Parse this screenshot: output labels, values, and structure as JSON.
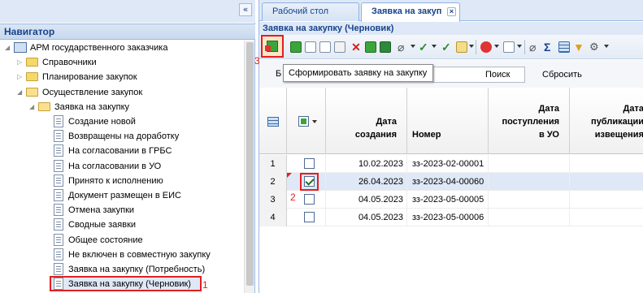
{
  "navigator": {
    "collapse_icon": "«",
    "title": "Навигатор",
    "tree": [
      {
        "label": "АРМ государственного заказчика",
        "kind": "apm",
        "indent": 0,
        "expanded": true
      },
      {
        "label": "Справочники",
        "kind": "folder",
        "indent": 1,
        "expanded": false
      },
      {
        "label": "Планирование закупок",
        "kind": "folder",
        "indent": 1,
        "expanded": false
      },
      {
        "label": "Осуществление закупок",
        "kind": "folder",
        "indent": 1,
        "expanded": true
      },
      {
        "label": "Заявка на закупку",
        "kind": "folder",
        "indent": 2,
        "expanded": true
      },
      {
        "label": "Создание новой",
        "kind": "doc",
        "indent": 3
      },
      {
        "label": "Возвращены на доработку",
        "kind": "doc",
        "indent": 3
      },
      {
        "label": "На согласовании в ГРБС",
        "kind": "doc",
        "indent": 3
      },
      {
        "label": "На согласовании в УО",
        "kind": "doc",
        "indent": 3
      },
      {
        "label": "Принято к исполнению",
        "kind": "doc",
        "indent": 3
      },
      {
        "label": "Документ размещен в ЕИС",
        "kind": "doc",
        "indent": 3
      },
      {
        "label": "Отмена закупки",
        "kind": "doc",
        "indent": 3
      },
      {
        "label": "Сводные заявки",
        "kind": "doc",
        "indent": 3
      },
      {
        "label": "Общее состояние",
        "kind": "doc",
        "indent": 3
      },
      {
        "label": "Не включен в совместную закупку",
        "kind": "doc",
        "indent": 3
      },
      {
        "label": "Заявка на закупку (Потребность)",
        "kind": "doc",
        "indent": 3
      },
      {
        "label": "Заявка на закупку (Черновик)",
        "kind": "doc",
        "indent": 3,
        "selected": true
      }
    ],
    "marker_1": "1"
  },
  "tabs": [
    {
      "label": "Рабочий стол",
      "active": false
    },
    {
      "label": "Заявка на закуп",
      "active": true,
      "close": "×"
    }
  ],
  "panel_title": "Заявка на закупку (Черновик)",
  "toolbar": {
    "tooltip": "Сформировать заявку на закупку",
    "marker_3": "3"
  },
  "filter": {
    "label": "Б",
    "search_label": "Поиск",
    "reset_label": "Сбросить"
  },
  "grid": {
    "columns": [
      {
        "label": "Дата\nсоздания"
      },
      {
        "label": "Номер"
      },
      {
        "label": "Дата\nпоступления\nв УО"
      },
      {
        "label": "Дата\nпубликации\nизвещения"
      }
    ],
    "rows": [
      {
        "num": "1",
        "checked": false,
        "date": "10.02.2023",
        "number": "зз-2023-02-00001"
      },
      {
        "num": "2",
        "checked": true,
        "date": "26.04.2023",
        "number": "зз-2023-04-00060",
        "selected": true
      },
      {
        "num": "3",
        "checked": false,
        "date": "04.05.2023",
        "number": "зз-2023-05-00005"
      },
      {
        "num": "4",
        "checked": false,
        "date": "04.05.2023",
        "number": "зз-2023-05-00006"
      }
    ],
    "marker_2": "2"
  },
  "colors": {
    "accent": "#15428b",
    "highlight": "#e02020",
    "header_bg": "#dfe8f6"
  }
}
